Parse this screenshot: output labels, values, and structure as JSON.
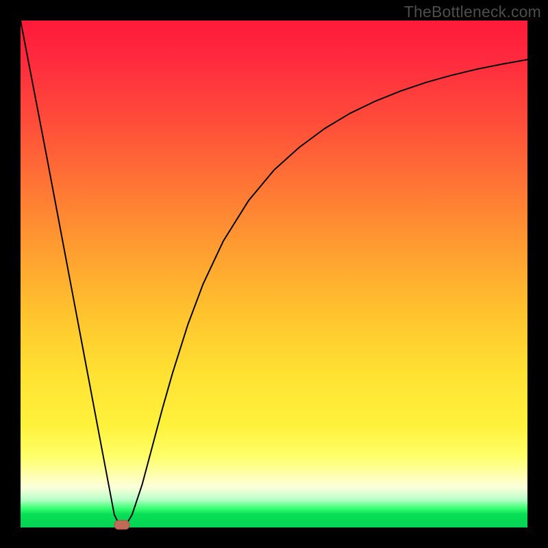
{
  "watermark": "TheBottleneck.com",
  "colors": {
    "frame_bg": "#000000",
    "curve_stroke": "#000000",
    "marker_fill": "#c06a57",
    "gradient_stops": [
      "#ff1a3a",
      "#ff7a34",
      "#ffc42e",
      "#ffff6a",
      "#3bff74",
      "#06d255"
    ]
  },
  "chart_data": {
    "type": "line",
    "title": "",
    "xlabel": "",
    "ylabel": "",
    "xlim": [
      0,
      100
    ],
    "ylim": [
      0,
      100
    ],
    "grid": false,
    "legend": false,
    "annotations": [
      "TheBottleneck.com"
    ],
    "marker": {
      "x": 20,
      "y": 0.5
    },
    "series": [
      {
        "name": "curve",
        "x": [
          0.0,
          5.0,
          10.0,
          15.0,
          18.5,
          19.5,
          20.8,
          22.0,
          24.0,
          26.0,
          28.0,
          30.0,
          33.0,
          36.0,
          40.0,
          45.0,
          50.0,
          55.0,
          60.0,
          65.0,
          70.0,
          75.0,
          80.0,
          85.0,
          90.0,
          95.0,
          100.0
        ],
        "values": [
          100.0,
          74.0,
          47.5,
          21.0,
          2.5,
          0.5,
          0.5,
          2.5,
          8.5,
          16.0,
          23.5,
          30.5,
          40.0,
          48.0,
          56.5,
          64.5,
          70.5,
          75.0,
          78.7,
          81.7,
          84.1,
          86.1,
          87.8,
          89.2,
          90.4,
          91.4,
          92.3
        ]
      }
    ]
  }
}
